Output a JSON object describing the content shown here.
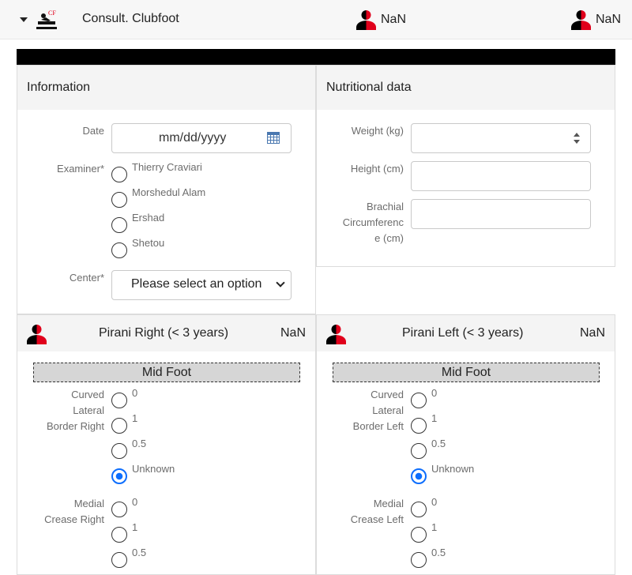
{
  "header": {
    "title": "Consult. Clubfoot",
    "app_icon_text": "CF",
    "stat_1": "NaN",
    "stat_2": "NaN"
  },
  "information": {
    "title": "Information",
    "date_label": "Date",
    "date_placeholder": "mm/dd/yyyy",
    "examiner_label": "Examiner*",
    "examiners": [
      "Thierry Craviari",
      "Morshedul Alam",
      "Ershad",
      "Shetou"
    ],
    "center_label": "Center*",
    "center_value": "Please select an option"
  },
  "nutrition": {
    "title": "Nutritional data",
    "weight_label": "Weight (kg)",
    "height_label": "Height (cm)",
    "brachial_label_lines": [
      "Brachial",
      "Circumferenc",
      "e (cm)"
    ]
  },
  "pirani_right": {
    "title": "Pirani Right (< 3 years)",
    "value": "NaN",
    "section": "Mid Foot",
    "curved_label_lines": [
      "Curved",
      "Lateral",
      "Border Right"
    ],
    "curved_options": [
      "0",
      "1",
      "0.5",
      "Unknown"
    ],
    "curved_selected": "Unknown",
    "medial_label_lines": [
      "Medial",
      "Crease Right"
    ],
    "medial_options": [
      "0",
      "1",
      "0.5"
    ]
  },
  "pirani_left": {
    "title": "Pirani Left (< 3 years)",
    "value": "NaN",
    "section": "Mid Foot",
    "curved_label_lines": [
      "Curved",
      "Lateral",
      "Border Left"
    ],
    "curved_options": [
      "0",
      "1",
      "0.5",
      "Unknown"
    ],
    "curved_selected": "Unknown",
    "medial_label_lines": [
      "Medial",
      "Crease Left"
    ],
    "medial_options": [
      "0",
      "1",
      "0.5"
    ]
  },
  "colors": {
    "accent": "#0d6efd",
    "person_red": "#e0001b",
    "person_black": "#000000"
  }
}
